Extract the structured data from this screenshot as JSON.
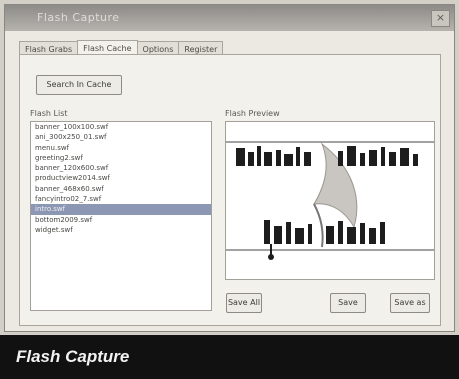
{
  "window": {
    "title": "Flash Capture",
    "close_glyph": "×"
  },
  "tabs": [
    {
      "label": "Flash Grabs"
    },
    {
      "label": "Flash Cache"
    },
    {
      "label": "Options"
    },
    {
      "label": "Register"
    }
  ],
  "toolbar": {
    "search_label": "Search In Cache"
  },
  "flash_list": {
    "label": "Flash List",
    "items": [
      "banner_100x100.swf",
      "ani_300x250_01.swf",
      "menu.swf",
      "greeting2.swf",
      "banner_120x600.swf",
      "productview2014.swf",
      "banner_468x60.swf",
      "fancyintro02_7.swf",
      "intro.swf",
      "bottom2009.swf",
      "widget.swf"
    ],
    "selected_index": 8
  },
  "preview": {
    "label": "Flash Preview"
  },
  "actions": {
    "save_all": "Save All",
    "save": "Save",
    "save_as": "Save as"
  },
  "caption": {
    "text": "Flash Capture"
  },
  "colors": {
    "selection": "#8c97b3",
    "caption_bg": "#111111",
    "titlebar": "#9b9893"
  }
}
